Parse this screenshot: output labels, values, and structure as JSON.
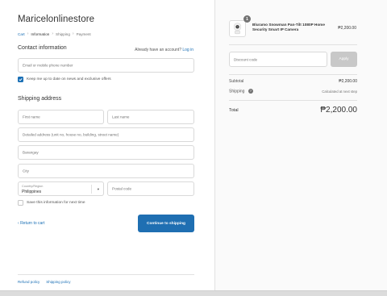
{
  "store": {
    "name": "Maricelonlinestore"
  },
  "breadcrumb": [
    {
      "label": "Cart",
      "state": "link"
    },
    {
      "label": "Information",
      "state": "current"
    },
    {
      "label": "Shipping",
      "state": "muted"
    },
    {
      "label": "Payment",
      "state": "muted"
    }
  ],
  "contact": {
    "title": "Contact information",
    "account_prompt": "Already have an account?",
    "login_label": "Log in",
    "email_placeholder": "Email or mobile phone number",
    "newsletter_label": "Keep me up to date on news and exclusive offers",
    "newsletter_checked": true
  },
  "shipping": {
    "title": "Shipping address",
    "first_name_placeholder": "First name",
    "last_name_placeholder": "Last name",
    "address_placeholder": "Detailed address (unit no, house no, building, street name)",
    "barangay_placeholder": "Barangay",
    "city_placeholder": "City",
    "country_label": "Country/Region",
    "country_value": "Philippines",
    "postal_placeholder": "Postal code",
    "save_info_label": "Save this information for next time",
    "save_info_checked": false
  },
  "actions": {
    "return_label": "Return to cart",
    "continue_label": "Continue to shipping"
  },
  "footer": {
    "links": [
      "Refund policy",
      "Shipping policy"
    ]
  },
  "order": {
    "item": {
      "name": "Bluramo Snowman Pan-Tilt 1080P Home Security Smart IP Camera",
      "quantity": "1",
      "price": "₱2,200.00"
    },
    "discount_placeholder": "Discount code",
    "apply_label": "Apply",
    "subtotal_label": "Subtotal",
    "subtotal_value": "₱2,200.00",
    "shipping_label": "Shipping",
    "shipping_value": "Calculated at next step",
    "total_label": "Total",
    "total_value": "₱2,200.00"
  },
  "colors": {
    "accent": "#1a6fb5",
    "button": "#1f6fb2",
    "sidebar_bg": "#fafafa",
    "apply_disabled": "#c8c8c8"
  },
  "icons": [
    "chevron-right-icon",
    "checkmark-icon",
    "chevron-down-icon",
    "chevron-left-icon",
    "question-icon",
    "camera-product-image"
  ]
}
